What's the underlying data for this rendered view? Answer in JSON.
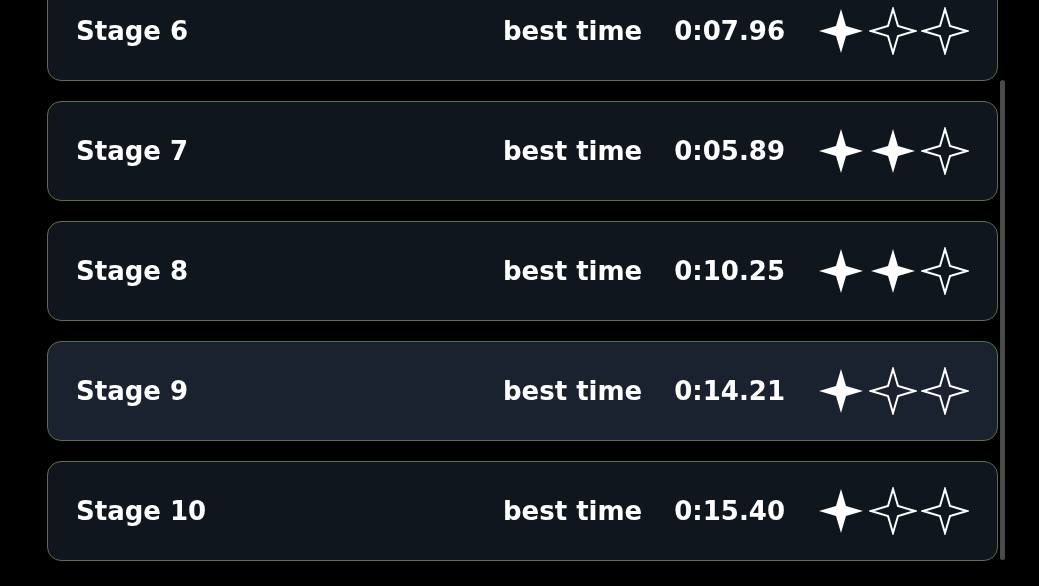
{
  "stages": [
    {
      "name": "Stage 6",
      "label": "best time",
      "time": "0:07.96",
      "stars": 1,
      "selected": false
    },
    {
      "name": "Stage 7",
      "label": "best time",
      "time": "0:05.89",
      "stars": 2,
      "selected": false
    },
    {
      "name": "Stage 8",
      "label": "best time",
      "time": "0:10.25",
      "stars": 2,
      "selected": false
    },
    {
      "name": "Stage 9",
      "label": "best time",
      "time": "0:14.21",
      "stars": 1,
      "selected": true
    },
    {
      "name": "Stage 10",
      "label": "best time",
      "time": "0:15.40",
      "stars": 1,
      "selected": false
    }
  ]
}
